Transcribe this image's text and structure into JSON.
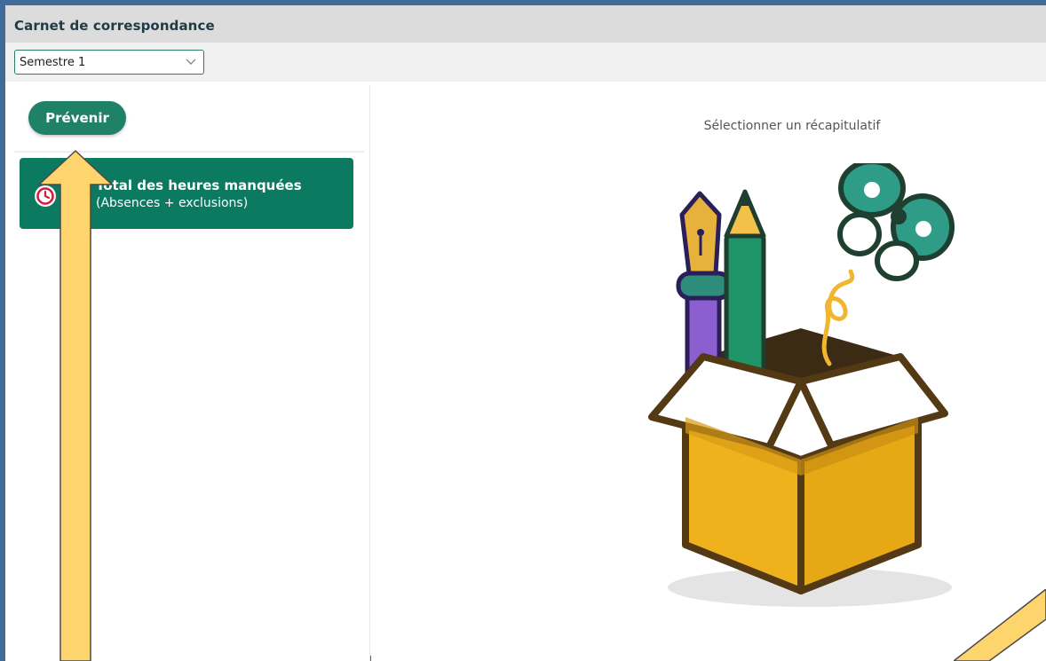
{
  "window": {
    "title": "Carnet de correspondance"
  },
  "filter": {
    "selected": "Semestre 1"
  },
  "left_panel": {
    "prevenir_label": "Prévenir",
    "recap_item": {
      "title": "Total des heures manquées",
      "subtitle": "(Absences + exclusions)"
    }
  },
  "right_panel": {
    "empty_label": "Sélectionner un récapitulatif"
  },
  "colors": {
    "accent": "#0b7a60",
    "button": "#1f8168",
    "frame": "#3f6a9a",
    "annotation": "#fed46c"
  }
}
